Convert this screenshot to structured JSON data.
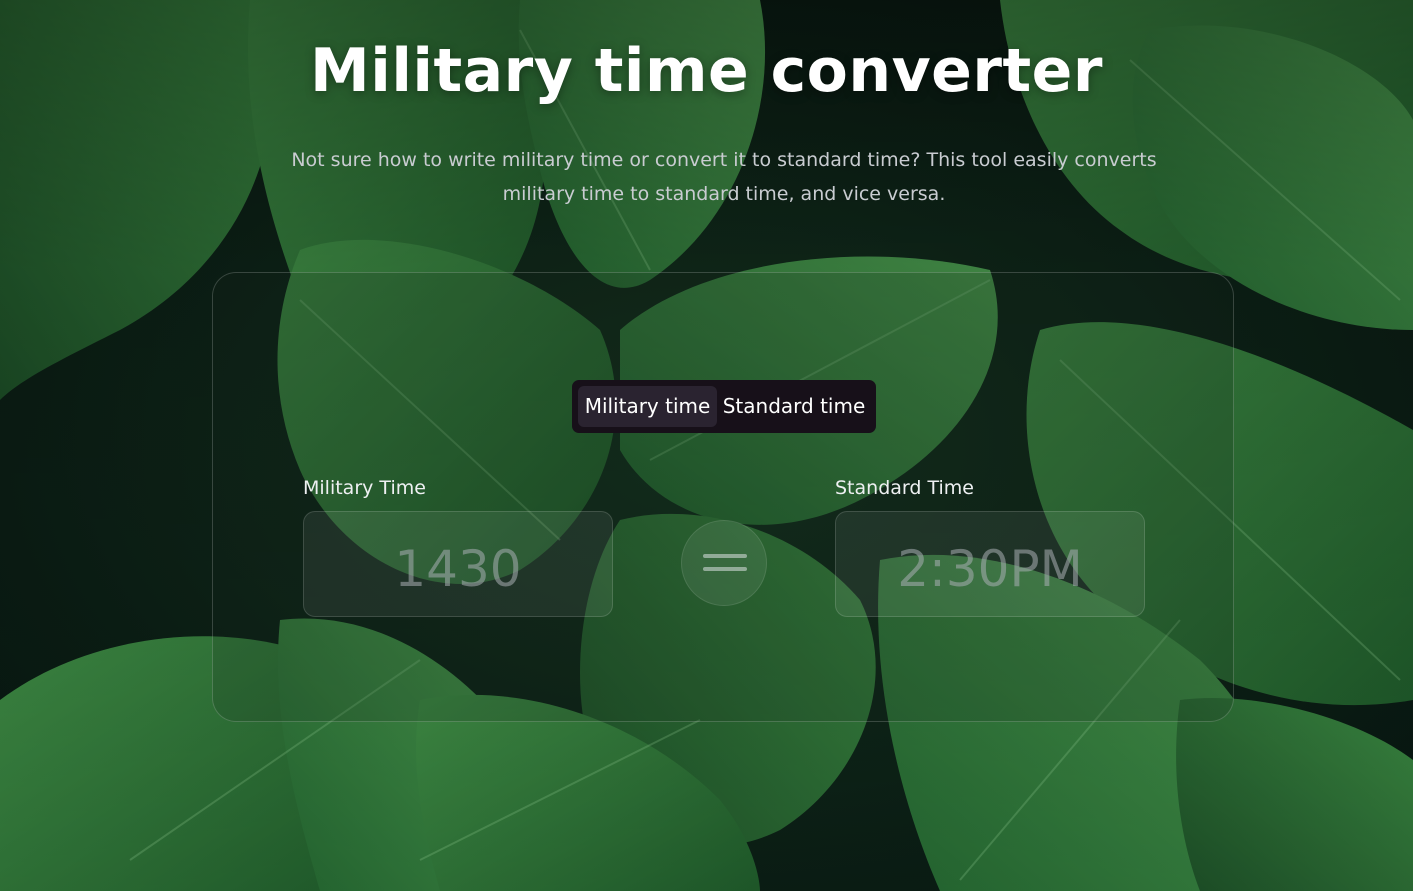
{
  "header": {
    "title": "Military time converter",
    "subtitle": "Not sure how to write military time or convert it to standard time? This tool easily converts military time to standard time, and vice versa."
  },
  "toggle": {
    "options": [
      {
        "label": "Military time",
        "active": true
      },
      {
        "label": "Standard time",
        "active": false
      }
    ]
  },
  "converter": {
    "military_label": "Military Time",
    "military_placeholder": "1430",
    "standard_label": "Standard Time",
    "standard_placeholder": "2:30PM",
    "equals_icon": "equals-icon"
  },
  "colors": {
    "title": "#ffffff",
    "toggle_bg": "#171019",
    "toggle_active": "#2a2330",
    "leaf_green": "#2f7a3a"
  }
}
